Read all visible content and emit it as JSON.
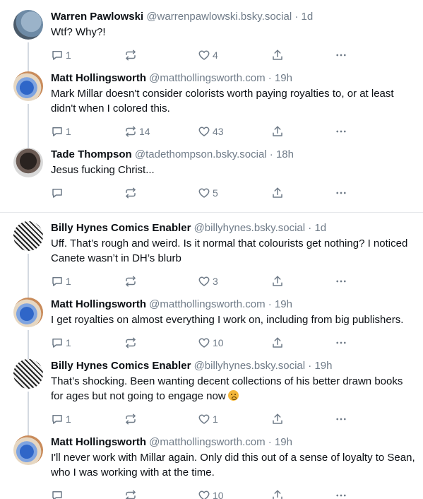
{
  "colors": {
    "text": "#0b0f14",
    "muted": "#6f7b88",
    "thread_line": "#d4d9e1",
    "divider": "#e6e8eb"
  },
  "threads": [
    {
      "posts": [
        {
          "name": "Warren Pawlowski",
          "handle": "@warrenpawlowski.bsky.social",
          "time": "1d",
          "text": "Wtf? Why?!",
          "replies": "1",
          "reposts": "",
          "likes": "4",
          "avatar": "warren"
        },
        {
          "name": "Matt Hollingsworth",
          "handle": "@matthollingsworth.com",
          "time": "19h",
          "text": "Mark Millar doesn't consider colorists worth paying royalties to, or at least didn't when I colored this.",
          "replies": "1",
          "reposts": "14",
          "likes": "43",
          "avatar": "matt"
        },
        {
          "name": "Tade Thompson",
          "handle": "@tadethompson.bsky.social",
          "time": "18h",
          "text": "Jesus fucking Christ...",
          "replies": "",
          "reposts": "",
          "likes": "5",
          "avatar": "tade"
        }
      ]
    },
    {
      "posts": [
        {
          "name": "Billy Hynes Comics Enabler",
          "handle": "@billyhynes.bsky.social",
          "time": "1d",
          "text": "Uff. That’s rough and weird.  Is it normal that colourists get nothing? I noticed Canete wasn’t in DH’s blurb",
          "replies": "1",
          "reposts": "",
          "likes": "3",
          "avatar": "billy"
        },
        {
          "name": "Matt Hollingsworth",
          "handle": "@matthollingsworth.com",
          "time": "19h",
          "text": "I get royalties on almost everything I work on, including from big publishers.",
          "replies": "1",
          "reposts": "",
          "likes": "10",
          "avatar": "matt"
        },
        {
          "name": "Billy Hynes Comics Enabler",
          "handle": "@billyhynes.bsky.social",
          "time": "19h",
          "text": "That’s shocking. Been wanting decent collections of his better drawn books for ages but not going to engage now",
          "emoji": true,
          "replies": "1",
          "reposts": "",
          "likes": "1",
          "avatar": "billy"
        },
        {
          "name": "Matt Hollingsworth",
          "handle": "@matthollingsworth.com",
          "time": "19h",
          "text": "I'll never work with Millar again. Only did this out of a sense of loyalty to Sean, who I was working with at the time.",
          "replies": "",
          "reposts": "",
          "likes": "10",
          "avatar": "matt"
        }
      ]
    }
  ],
  "icons": {
    "reply": "reply-icon",
    "repost": "repost-icon",
    "like": "heart-icon",
    "share": "share-icon",
    "more": "more-icon"
  },
  "separator": " · "
}
